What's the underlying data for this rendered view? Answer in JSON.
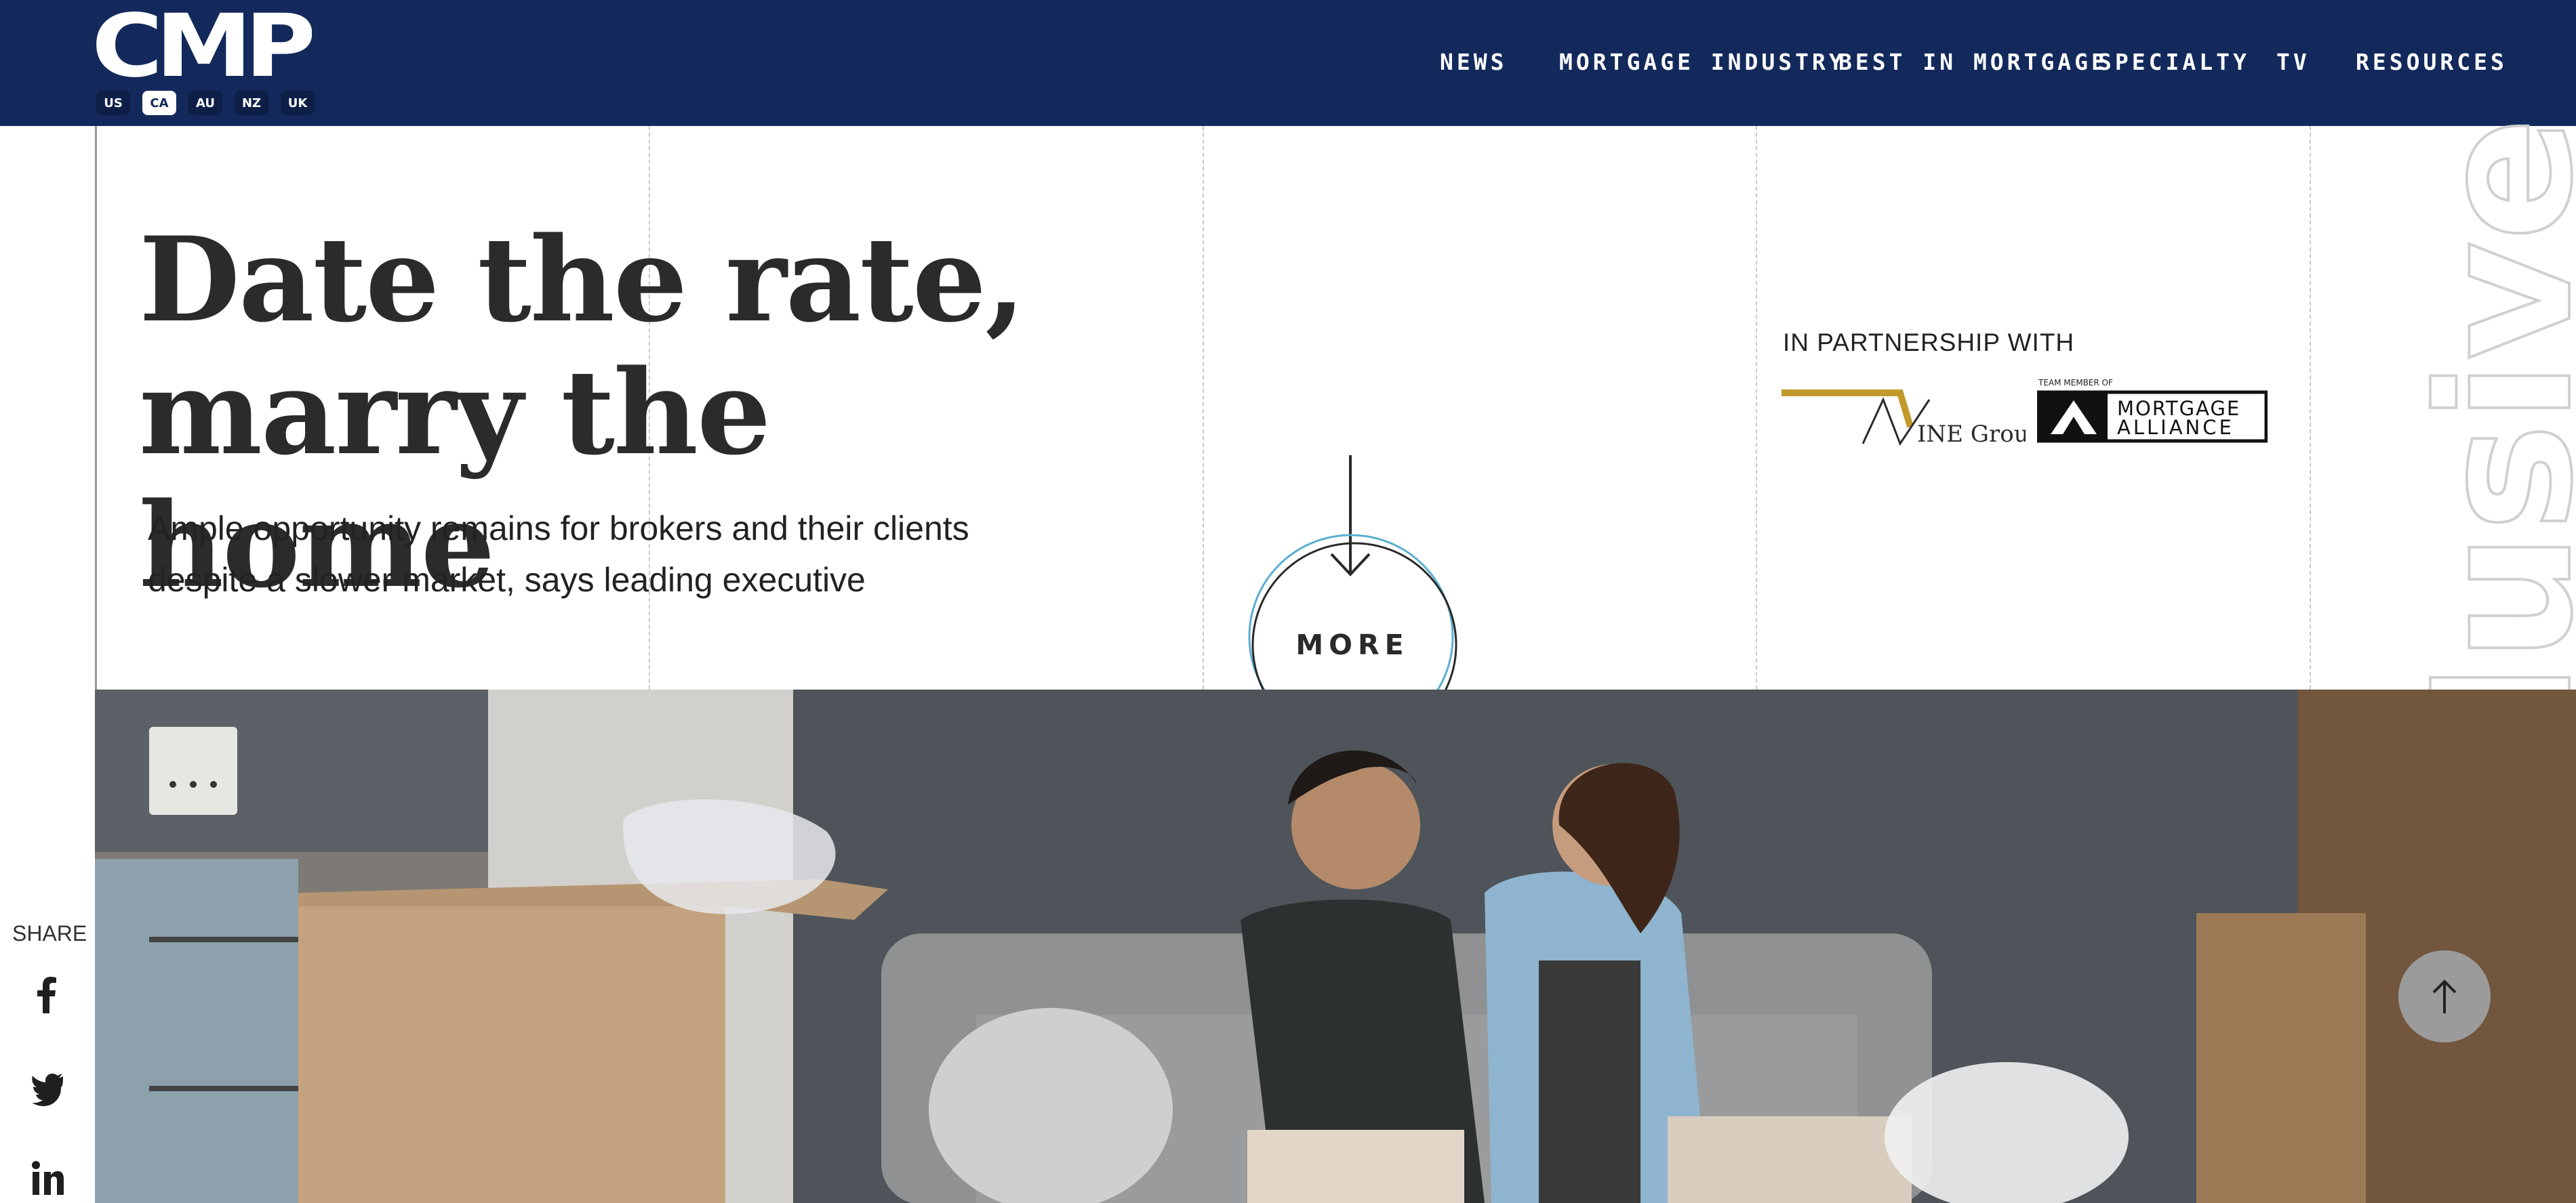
{
  "header": {
    "logo_text": "CMP",
    "regions": [
      {
        "code": "US",
        "active": false
      },
      {
        "code": "CA",
        "active": true
      },
      {
        "code": "AU",
        "active": false
      },
      {
        "code": "NZ",
        "active": false
      },
      {
        "code": "UK",
        "active": false
      }
    ],
    "nav": [
      "NEWS",
      "MORTGAGE INDUSTRY",
      "BEST IN MORTGAGE",
      "SPECIALTY",
      "TV",
      "RESOURCES"
    ]
  },
  "hero": {
    "headline_line1": "Date the rate,",
    "headline_line2": "marry the home",
    "subhead_line1": "Ample opportunity remains for brokers and their clients",
    "subhead_line2": "despite a slower market, says leading executive",
    "more_label": "MORE",
    "watermark_text": "lusive"
  },
  "partnership": {
    "label": "IN PARTNERSHIP WITH",
    "vine_logo_text": "INE Group",
    "alliance_small": "TEAM MEMBER OF",
    "alliance_line1": "MORTGAGE",
    "alliance_line2": "ALLIANCE"
  },
  "share": {
    "label": "SHARE",
    "icons": [
      "facebook-icon",
      "twitter-icon",
      "linkedin-icon"
    ]
  },
  "colors": {
    "header_bg": "#13295b",
    "accent_gold": "#c29a2c",
    "more_ring_blue": "#5aaed0"
  }
}
